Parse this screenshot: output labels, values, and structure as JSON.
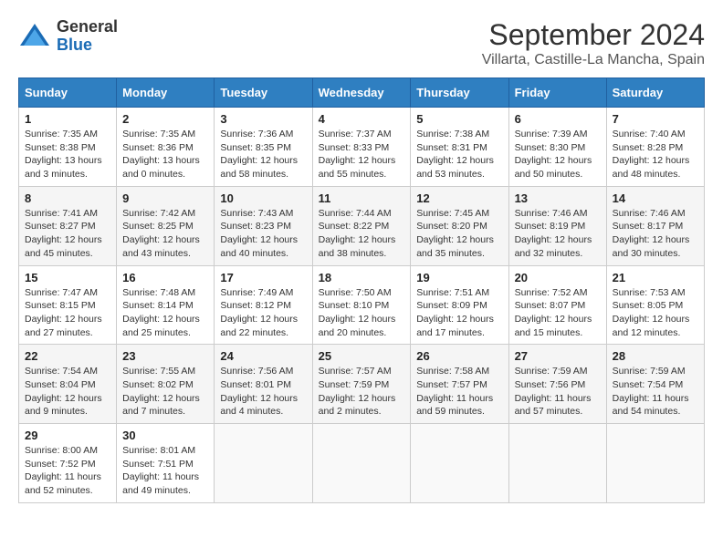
{
  "header": {
    "logo_general": "General",
    "logo_blue": "Blue",
    "month_title": "September 2024",
    "location": "Villarta, Castille-La Mancha, Spain"
  },
  "weekdays": [
    "Sunday",
    "Monday",
    "Tuesday",
    "Wednesday",
    "Thursday",
    "Friday",
    "Saturday"
  ],
  "weeks": [
    [
      {
        "day": "1",
        "info": "Sunrise: 7:35 AM\nSunset: 8:38 PM\nDaylight: 13 hours\nand 3 minutes."
      },
      {
        "day": "2",
        "info": "Sunrise: 7:35 AM\nSunset: 8:36 PM\nDaylight: 13 hours\nand 0 minutes."
      },
      {
        "day": "3",
        "info": "Sunrise: 7:36 AM\nSunset: 8:35 PM\nDaylight: 12 hours\nand 58 minutes."
      },
      {
        "day": "4",
        "info": "Sunrise: 7:37 AM\nSunset: 8:33 PM\nDaylight: 12 hours\nand 55 minutes."
      },
      {
        "day": "5",
        "info": "Sunrise: 7:38 AM\nSunset: 8:31 PM\nDaylight: 12 hours\nand 53 minutes."
      },
      {
        "day": "6",
        "info": "Sunrise: 7:39 AM\nSunset: 8:30 PM\nDaylight: 12 hours\nand 50 minutes."
      },
      {
        "day": "7",
        "info": "Sunrise: 7:40 AM\nSunset: 8:28 PM\nDaylight: 12 hours\nand 48 minutes."
      }
    ],
    [
      {
        "day": "8",
        "info": "Sunrise: 7:41 AM\nSunset: 8:27 PM\nDaylight: 12 hours\nand 45 minutes."
      },
      {
        "day": "9",
        "info": "Sunrise: 7:42 AM\nSunset: 8:25 PM\nDaylight: 12 hours\nand 43 minutes."
      },
      {
        "day": "10",
        "info": "Sunrise: 7:43 AM\nSunset: 8:23 PM\nDaylight: 12 hours\nand 40 minutes."
      },
      {
        "day": "11",
        "info": "Sunrise: 7:44 AM\nSunset: 8:22 PM\nDaylight: 12 hours\nand 38 minutes."
      },
      {
        "day": "12",
        "info": "Sunrise: 7:45 AM\nSunset: 8:20 PM\nDaylight: 12 hours\nand 35 minutes."
      },
      {
        "day": "13",
        "info": "Sunrise: 7:46 AM\nSunset: 8:19 PM\nDaylight: 12 hours\nand 32 minutes."
      },
      {
        "day": "14",
        "info": "Sunrise: 7:46 AM\nSunset: 8:17 PM\nDaylight: 12 hours\nand 30 minutes."
      }
    ],
    [
      {
        "day": "15",
        "info": "Sunrise: 7:47 AM\nSunset: 8:15 PM\nDaylight: 12 hours\nand 27 minutes."
      },
      {
        "day": "16",
        "info": "Sunrise: 7:48 AM\nSunset: 8:14 PM\nDaylight: 12 hours\nand 25 minutes."
      },
      {
        "day": "17",
        "info": "Sunrise: 7:49 AM\nSunset: 8:12 PM\nDaylight: 12 hours\nand 22 minutes."
      },
      {
        "day": "18",
        "info": "Sunrise: 7:50 AM\nSunset: 8:10 PM\nDaylight: 12 hours\nand 20 minutes."
      },
      {
        "day": "19",
        "info": "Sunrise: 7:51 AM\nSunset: 8:09 PM\nDaylight: 12 hours\nand 17 minutes."
      },
      {
        "day": "20",
        "info": "Sunrise: 7:52 AM\nSunset: 8:07 PM\nDaylight: 12 hours\nand 15 minutes."
      },
      {
        "day": "21",
        "info": "Sunrise: 7:53 AM\nSunset: 8:05 PM\nDaylight: 12 hours\nand 12 minutes."
      }
    ],
    [
      {
        "day": "22",
        "info": "Sunrise: 7:54 AM\nSunset: 8:04 PM\nDaylight: 12 hours\nand 9 minutes."
      },
      {
        "day": "23",
        "info": "Sunrise: 7:55 AM\nSunset: 8:02 PM\nDaylight: 12 hours\nand 7 minutes."
      },
      {
        "day": "24",
        "info": "Sunrise: 7:56 AM\nSunset: 8:01 PM\nDaylight: 12 hours\nand 4 minutes."
      },
      {
        "day": "25",
        "info": "Sunrise: 7:57 AM\nSunset: 7:59 PM\nDaylight: 12 hours\nand 2 minutes."
      },
      {
        "day": "26",
        "info": "Sunrise: 7:58 AM\nSunset: 7:57 PM\nDaylight: 11 hours\nand 59 minutes."
      },
      {
        "day": "27",
        "info": "Sunrise: 7:59 AM\nSunset: 7:56 PM\nDaylight: 11 hours\nand 57 minutes."
      },
      {
        "day": "28",
        "info": "Sunrise: 7:59 AM\nSunset: 7:54 PM\nDaylight: 11 hours\nand 54 minutes."
      }
    ],
    [
      {
        "day": "29",
        "info": "Sunrise: 8:00 AM\nSunset: 7:52 PM\nDaylight: 11 hours\nand 52 minutes."
      },
      {
        "day": "30",
        "info": "Sunrise: 8:01 AM\nSunset: 7:51 PM\nDaylight: 11 hours\nand 49 minutes."
      },
      null,
      null,
      null,
      null,
      null
    ]
  ]
}
